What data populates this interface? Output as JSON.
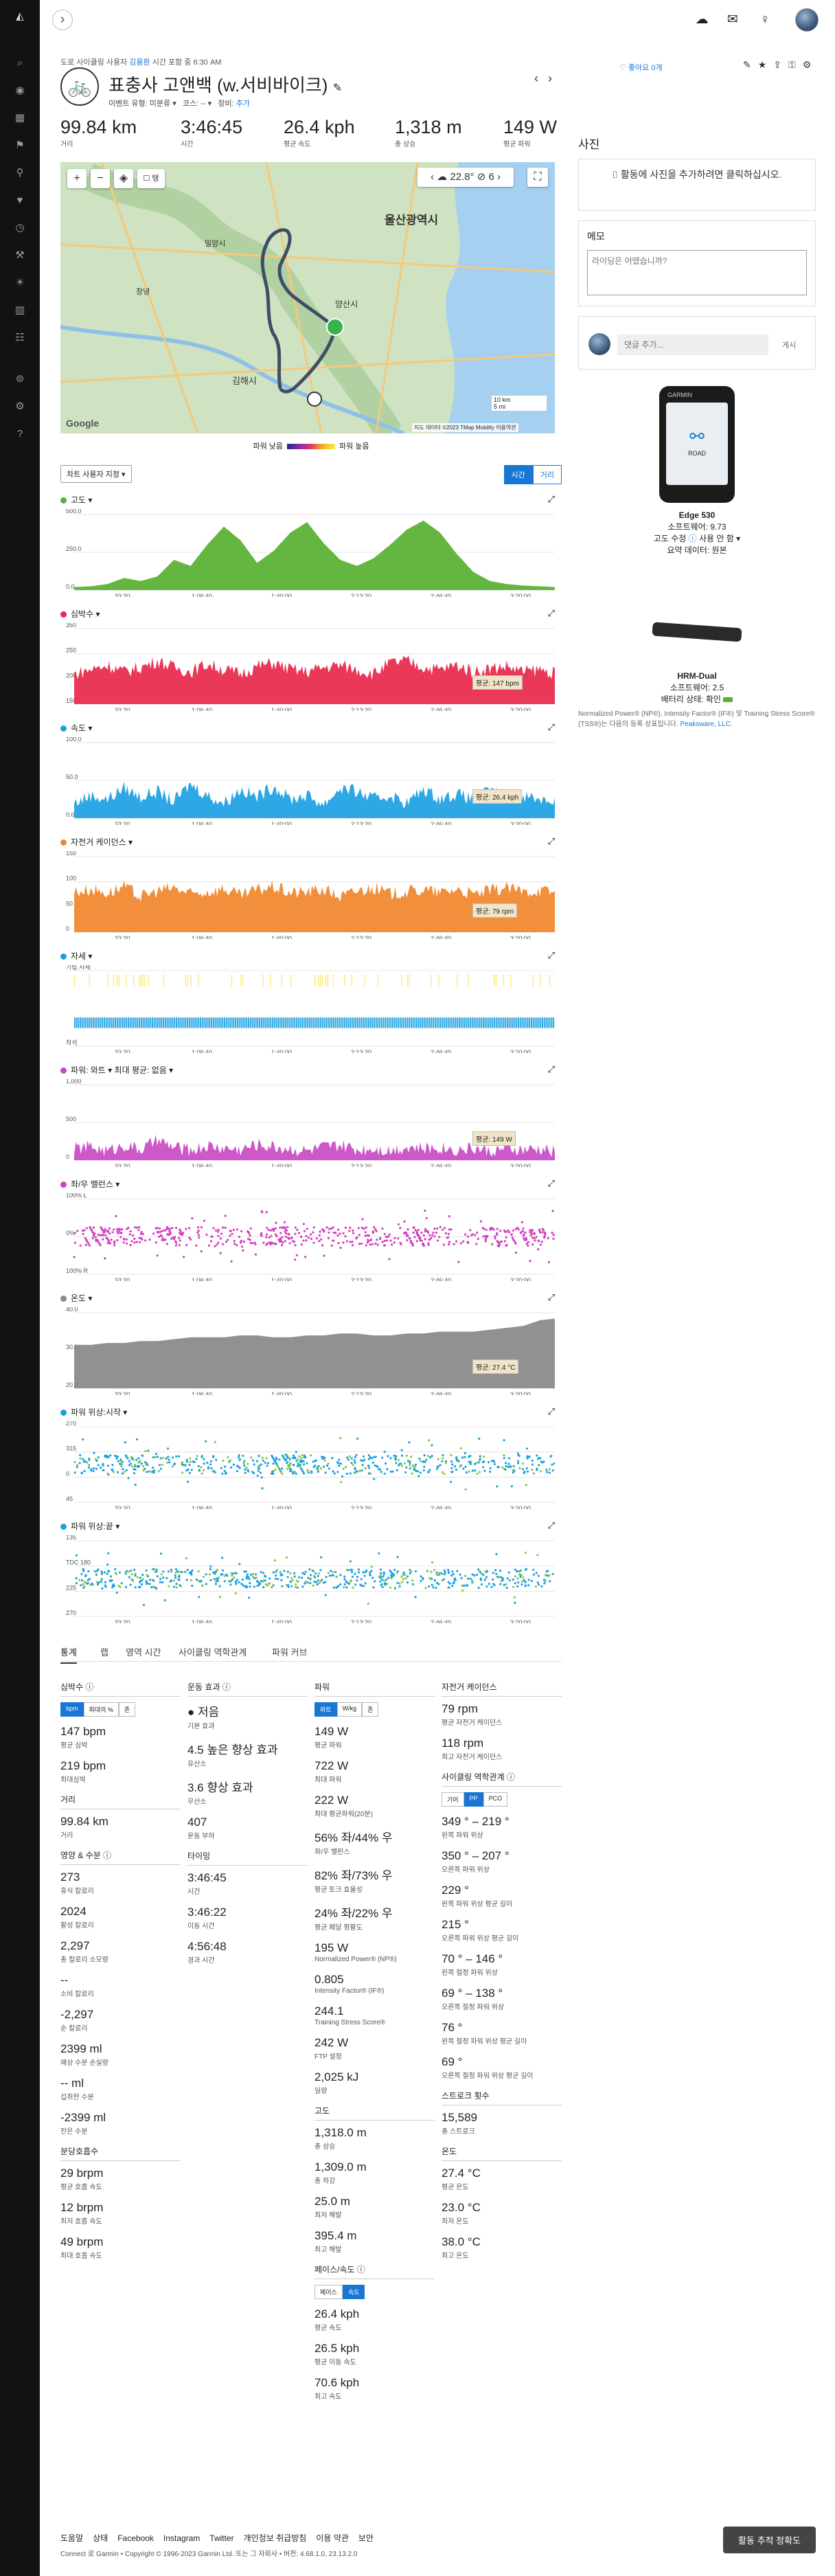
{
  "topbar": {
    "collapse": "›"
  },
  "activity": {
    "breadcrumb": {
      "type": "도로 사이클링",
      "by": "사용자",
      "user": "김용환",
      "time": "시간 포함 중 6:30 AM"
    },
    "title": "표충사 고앤백 (w.서비바이크)",
    "meta": {
      "event_type": "이벤트 유형: 미분류",
      "course": "코스: --",
      "gear_label": "장비:",
      "gear_add": "추가"
    },
    "like": "좋아요 0개",
    "stats": [
      {
        "value": "99.84 km",
        "label": "거리"
      },
      {
        "value": "3:46:45",
        "label": "시간"
      },
      {
        "value": "26.4 kph",
        "label": "평균 속도"
      },
      {
        "value": "1,318 m",
        "label": "총 상승"
      },
      {
        "value": "149 W",
        "label": "평균 파워"
      }
    ]
  },
  "map": {
    "temp": "22.8°",
    "temp_count": "6",
    "layer_label": "탱",
    "city_ulsan": "울산광역시",
    "city_yangsan": "양산시",
    "city_gimhae": "김해시",
    "city_miryang": "밀양시",
    "city_changnyeong": "창녕",
    "brand": "Google",
    "copyright": "지도 데이터 ©2023 TMap Mobility",
    "terms": "이용약관",
    "scale_km": "10 km",
    "scale_mi": "5 mi"
  },
  "legend": {
    "low": "파워 낮음",
    "high": "파워 높음"
  },
  "chart_toolbar": {
    "select": "차트 사용자 지정",
    "time": "시간",
    "dist": "거리"
  },
  "chart_data": [
    {
      "type": "area",
      "title": "고도",
      "color": "#58b031",
      "ylim": [
        0,
        500
      ],
      "yticks": [
        "500.0",
        "250.0",
        "0.0"
      ],
      "xticks": [
        "33:20",
        "1:06:40",
        "1:40:00",
        "2:13:20",
        "2:46:40",
        "3:20:00"
      ],
      "values": [
        20,
        25,
        40,
        80,
        60,
        90,
        200,
        160,
        300,
        420,
        330,
        180,
        260,
        380,
        450,
        310,
        200,
        160,
        210,
        300,
        400,
        460,
        380,
        240,
        120,
        60,
        40,
        30,
        25,
        20
      ],
      "avg_label": ""
    },
    {
      "type": "area",
      "title": "심박수",
      "color": "#e8274b",
      "ylim": [
        0,
        350
      ],
      "yticks": [
        "350",
        "250",
        "200",
        "150"
      ],
      "xticks": [
        "33:20",
        "1:06:40",
        "1:40:00",
        "2:13:20",
        "2:46:40",
        "3:20:00"
      ],
      "values": [
        140,
        160,
        180,
        150,
        170,
        200,
        170,
        150,
        185,
        160,
        140,
        175,
        190,
        160,
        150,
        170,
        180,
        160,
        140,
        190,
        200,
        170,
        160,
        180,
        150,
        165,
        175,
        150,
        160,
        140
      ],
      "avg_label": "평균: 147 bpm"
    },
    {
      "type": "area",
      "title": "속도",
      "color": "#1ba1e2",
      "ylim": [
        0,
        100
      ],
      "yticks": [
        "100.0",
        "50.0",
        "0.0"
      ],
      "xticks": [
        "33:20",
        "1:06:40",
        "1:40:00",
        "2:13:20",
        "2:46:40",
        "3:20:00"
      ],
      "values": [
        20,
        30,
        25,
        40,
        28,
        35,
        22,
        45,
        30,
        20,
        38,
        28,
        42,
        25,
        30,
        18,
        40,
        35,
        25,
        30,
        20,
        38,
        26,
        32,
        24,
        36,
        28,
        30,
        26,
        22
      ],
      "avg_label": "평균: 26.4 kph"
    },
    {
      "type": "area",
      "title": "자전거 케이던스",
      "color": "#f0862b",
      "ylim": [
        0,
        150
      ],
      "yticks": [
        "150",
        "100",
        "50",
        "0"
      ],
      "xticks": [
        "33:20",
        "1:06:40",
        "1:40:00",
        "2:13:20",
        "2:46:40",
        "3:20:00"
      ],
      "values": [
        80,
        85,
        78,
        90,
        70,
        82,
        88,
        75,
        80,
        86,
        72,
        84,
        90,
        78,
        80,
        85,
        70,
        82,
        88,
        76,
        80,
        84,
        78,
        86,
        74,
        82,
        88,
        80,
        84,
        78
      ],
      "avg_label": "평균: 79 rpm"
    },
    {
      "type": "bars",
      "title": "자세",
      "color": "#1ba1e2",
      "ylim": [
        0,
        1
      ],
      "yticks": [
        "기립 자세",
        "착석"
      ],
      "xticks": [
        "33:20",
        "1:06:40",
        "1:40:00",
        "2:13:20",
        "2:46:40",
        "3:20:00"
      ],
      "values": [],
      "avg_label": ""
    },
    {
      "type": "area",
      "title": "파워: 와트",
      "extra": "최대 평균: 없음",
      "color": "#c94ac6",
      "ylim": [
        0,
        1000
      ],
      "yticks": [
        "1,000",
        "500",
        "0"
      ],
      "xticks": [
        "33:20",
        "1:06:40",
        "1:40:00",
        "2:13:20",
        "2:46:40",
        "3:20:00"
      ],
      "values": [
        150,
        180,
        120,
        200,
        140,
        260,
        170,
        130,
        190,
        160,
        140,
        210,
        180,
        150,
        120,
        170,
        190,
        140,
        160,
        130,
        180,
        150,
        170,
        140,
        160,
        120,
        150,
        130,
        140,
        120
      ],
      "avg_label": "평균: 149 W"
    },
    {
      "type": "scatter",
      "title": "좌/우 밸런스",
      "color": "#d23fc0",
      "ylim": [
        -100,
        100
      ],
      "yticks": [
        "100% L",
        "0%",
        "100% R"
      ],
      "xticks": [
        "33:20",
        "1:06:40",
        "1:40:00",
        "2:13:20",
        "2:46:40",
        "3:20:00"
      ],
      "values": [],
      "avg_label": ""
    },
    {
      "type": "area",
      "title": "온도",
      "color": "#888888",
      "ylim": [
        0,
        40
      ],
      "yticks": [
        "40.0",
        "30.0",
        "20.0"
      ],
      "xticks": [
        "33:20",
        "1:06:40",
        "1:40:00",
        "2:13:20",
        "2:46:40",
        "3:20:00"
      ],
      "values": [
        23,
        23,
        24,
        24,
        25,
        25,
        26,
        27,
        27,
        27,
        28,
        28,
        27,
        27,
        28,
        28,
        29,
        29,
        28,
        28,
        29,
        29,
        30,
        30,
        30,
        31,
        32,
        33,
        36,
        37
      ],
      "avg_label": "평균: 27.4 °C"
    },
    {
      "type": "scatter",
      "title": "파워 위상:시작",
      "color": "#1ba1e2",
      "ylim": [
        0,
        360
      ],
      "yticks": [
        "270",
        "315",
        "0",
        "45"
      ],
      "xticks": [
        "33:20",
        "1:06:40",
        "1:40:00",
        "2:13:20",
        "2:46:40",
        "3:20:00"
      ],
      "values": [],
      "avg_label": ""
    },
    {
      "type": "scatter",
      "title": "파워 위상:끝",
      "color": "#1ba1e2",
      "ylim": [
        0,
        360
      ],
      "yticks": [
        "135",
        "TDC 180",
        "225",
        "270"
      ],
      "xticks": [
        "33:20",
        "1:06:40",
        "1:40:00",
        "2:13:20",
        "2:46:40",
        "3:20:00"
      ],
      "values": [],
      "avg_label": ""
    }
  ],
  "tabs": [
    "통계",
    "랩",
    "영역 시간",
    "사이클링 역학관계",
    "파워 커브"
  ],
  "stats_grid": {
    "hr": {
      "title": "심박수",
      "seg": [
        "bpm",
        "최대의 %",
        "존"
      ],
      "items": [
        {
          "v": "147 bpm",
          "l": "평균 심박"
        },
        {
          "v": "219 bpm",
          "l": "최대심박"
        }
      ]
    },
    "dist": {
      "title": "거리",
      "items": [
        {
          "v": "99.84 km",
          "l": "거리"
        }
      ]
    },
    "nutrition": {
      "title": "영양 & 수분",
      "items": [
        {
          "v": "273",
          "l": "휴식 칼로리"
        },
        {
          "v": "2024",
          "l": "활성 칼로리"
        },
        {
          "v": "2,297",
          "l": "총 칼로리 소모량"
        },
        {
          "v": "--",
          "l": "소비 칼로리"
        },
        {
          "v": "-2,297",
          "l": "순 칼로리"
        },
        {
          "v": "2399 ml",
          "l": "예상 수분 손실량"
        },
        {
          "v": "-- ml",
          "l": "섭취한 수분"
        },
        {
          "v": "-2399 ml",
          "l": "잔은 수분"
        }
      ]
    },
    "resp": {
      "title": "분당호흡수",
      "items": [
        {
          "v": "29 brpm",
          "l": "평균 호흡 속도"
        },
        {
          "v": "12 brpm",
          "l": "최저 호흡 속도"
        },
        {
          "v": "49 brpm",
          "l": "최대 호흡 속도"
        }
      ]
    },
    "te": {
      "title": "운동 효과",
      "primary": "저음",
      "primary_l": "기본 효과",
      "items": [
        {
          "v": "4.5 높은 향상 효과",
          "l": "유산소"
        },
        {
          "v": "3.6 향상 효과",
          "l": "무산소"
        },
        {
          "v": "407",
          "l": "운동 부하"
        }
      ]
    },
    "timing": {
      "title": "타이밍",
      "items": [
        {
          "v": "3:46:45",
          "l": "시간"
        },
        {
          "v": "3:46:22",
          "l": "이동 시간"
        },
        {
          "v": "4:56:48",
          "l": "경과 시간"
        }
      ]
    },
    "power": {
      "title": "파워",
      "seg": [
        "와트",
        "W/kg",
        "존"
      ],
      "items": [
        {
          "v": "149 W",
          "l": "평균 파워"
        },
        {
          "v": "722 W",
          "l": "최대 파워"
        },
        {
          "v": "222 W",
          "l": "최대 평균파워(20분)"
        },
        {
          "v": "56% 좌/44% 우",
          "l": "좌/우 밸런스"
        },
        {
          "v": "82% 좌/73% 우",
          "l": "평균 토크 효율성"
        },
        {
          "v": "24% 좌/22% 우",
          "l": "평균 페달 평활도"
        },
        {
          "v": "195 W",
          "l": "Normalized Power® (NP®)"
        },
        {
          "v": "0.805",
          "l": "Intensity Factor® (IF®)"
        },
        {
          "v": "244.1",
          "l": "Training Stress Score®"
        },
        {
          "v": "242 W",
          "l": "FTP 설정"
        },
        {
          "v": "2,025 kJ",
          "l": "일량"
        }
      ]
    },
    "elev": {
      "title": "고도",
      "items": [
        {
          "v": "1,318.0 m",
          "l": "총 상승"
        },
        {
          "v": "1,309.0 m",
          "l": "총 하강"
        },
        {
          "v": "25.0 m",
          "l": "최저 해발"
        },
        {
          "v": "395.4 m",
          "l": "최고 해발"
        }
      ]
    },
    "pace": {
      "title": "페이스/속도",
      "seg": [
        "페이스",
        "속도"
      ],
      "items": [
        {
          "v": "26.4 kph",
          "l": "평균 속도"
        },
        {
          "v": "26.5 kph",
          "l": "평균 이동 속도"
        },
        {
          "v": "70.6 kph",
          "l": "최고 속도"
        }
      ]
    },
    "cad": {
      "title": "자전거 케이던스",
      "items": [
        {
          "v": "79 rpm",
          "l": "평균 자전거 케이던스"
        },
        {
          "v": "118 rpm",
          "l": "최고 자전거 케이던스"
        }
      ]
    },
    "dyn": {
      "title": "사이클링 역학관계",
      "seg": [
        "기어",
        "PP",
        "PCO"
      ],
      "items": [
        {
          "v": "349 ° – 219 °",
          "l": "왼쪽 파워 위상"
        },
        {
          "v": "350 ° – 207 °",
          "l": "오른쪽 파워 위상"
        },
        {
          "v": "229 °",
          "l": "왼쪽 파워 위상 평균 길이"
        },
        {
          "v": "215 °",
          "l": "오른쪽 파워 위상 평균 길이"
        },
        {
          "v": "70 ° – 146 °",
          "l": "왼쪽 절정 파워 위상"
        },
        {
          "v": "69 ° – 138 °",
          "l": "오른쪽 절정 파워 위상"
        },
        {
          "v": "76 °",
          "l": "왼쪽 절정 파워 위상 평균 길이"
        },
        {
          "v": "69 °",
          "l": "오른쪽 절정 파워 위상 평균 길이"
        }
      ]
    },
    "stroke": {
      "title": "스트로크 횟수",
      "items": [
        {
          "v": "15,589",
          "l": "총 스트로크"
        }
      ]
    },
    "temp": {
      "title": "온도",
      "items": [
        {
          "v": "27.4 °C",
          "l": "평균 온도"
        },
        {
          "v": "23.0 °C",
          "l": "최저 온도"
        },
        {
          "v": "38.0 °C",
          "l": "최고 온도"
        }
      ]
    }
  },
  "right": {
    "photos_h": "사진",
    "photos_add": "활동에 사진을 추가하려면 클릭하십시오.",
    "notes_h": "메모",
    "notes_ph": "라이딩은 어땠습니까?",
    "comment_ph": "댓글 추가...",
    "comment_btn": "게시",
    "device1": {
      "brand": "GARMIN",
      "screen": "ROAD",
      "name": "Edge 530",
      "sw": "소프트웨어: 9.73",
      "elev_fix": "고도 수정",
      "elev_state": "사용 안 함",
      "summary": "요약 데이터: 원본"
    },
    "device2": {
      "name": "HRM-Dual",
      "sw": "소프트웨어: 2.5",
      "battery": "배터리 상태: 확인"
    },
    "tm": "Normalized Power® (NP®), Intensity Factor® (IF®) 및 Training Stress Score® (TSS®)는 다음의 등록 상표입니다.",
    "tm_link": "Peaksware, LLC."
  },
  "footer": {
    "links": [
      "도움말",
      "상태",
      "Facebook",
      "Instagram",
      "Twitter",
      "개인정보 취급방침",
      "이용 약관",
      "보안"
    ],
    "copyright": "Connect 로 Garmin • Copyright © 1996-2023 Garmin Ltd. 또는 그 자회사 • 버전: 4.68.1.0, 23.13.2.0",
    "feedback": "활동 추적 정확도"
  }
}
